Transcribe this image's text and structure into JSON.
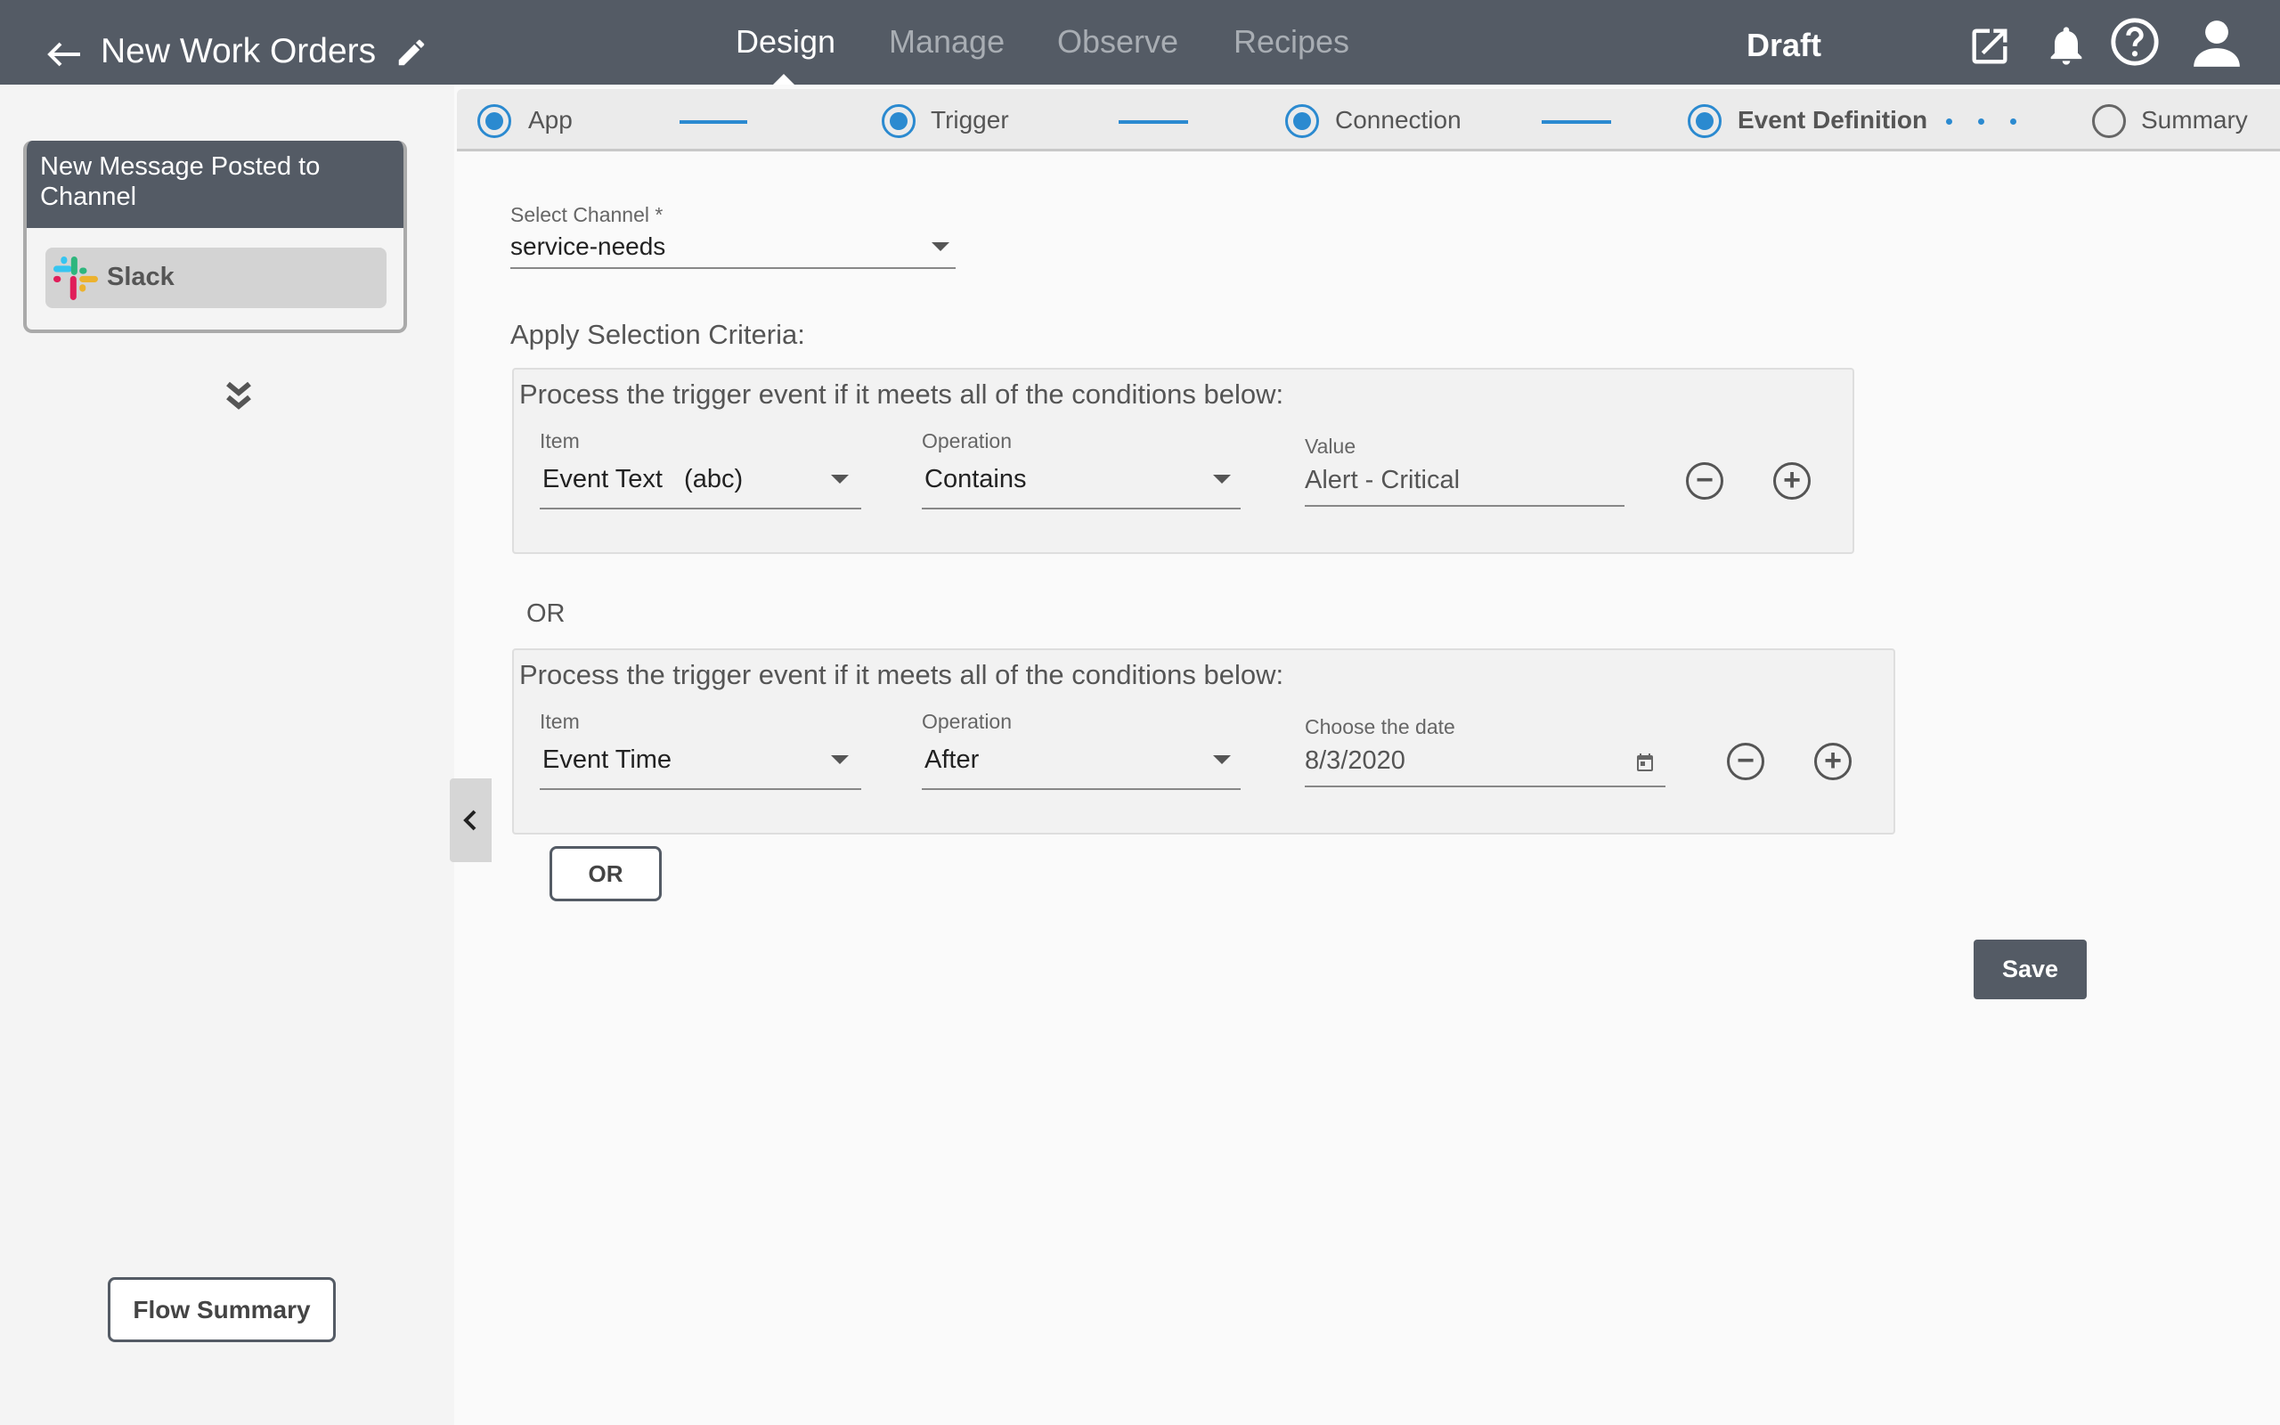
{
  "header": {
    "title": "New Work Orders",
    "status": "Draft",
    "tabs": [
      {
        "label": "Design",
        "active": true
      },
      {
        "label": "Manage"
      },
      {
        "label": "Observe"
      },
      {
        "label": "Recipes"
      }
    ],
    "icons": [
      "back-arrow-icon",
      "pencil-icon",
      "external-link-icon",
      "bell-icon",
      "help-icon",
      "user-icon"
    ]
  },
  "stepper": {
    "steps": [
      {
        "label": "App",
        "state": "done"
      },
      {
        "label": "Trigger",
        "state": "done"
      },
      {
        "label": "Connection",
        "state": "done"
      },
      {
        "label": "Event Definition",
        "state": "current"
      },
      {
        "label": "Summary",
        "state": "pending"
      }
    ]
  },
  "sidebar": {
    "card_title": "New Message Posted to Channel",
    "app_label": "Slack",
    "flow_summary": "Flow Summary"
  },
  "form": {
    "channel": {
      "label": "Select Channel *",
      "value": "service-needs"
    },
    "criteria_label": "Apply Selection Criteria:",
    "or_text": "OR",
    "groups": [
      {
        "heading": "Process the trigger event if it meets all of the conditions below:",
        "item_label": "Item",
        "item": "Event Text   (abc)",
        "op_label": "Operation",
        "op": "Contains",
        "value_label": "Value",
        "value": "Alert - Critical"
      },
      {
        "heading": "Process the trigger event if it meets all of the conditions below:",
        "item_label": "Item",
        "item": "Event Time",
        "op_label": "Operation",
        "op": "After",
        "value_label": "Choose the date",
        "value": "8/3/2020"
      }
    ],
    "or_button": "OR",
    "save_button": "Save"
  },
  "colors": {
    "header": "#545b65",
    "accent": "#2b8ad0"
  }
}
